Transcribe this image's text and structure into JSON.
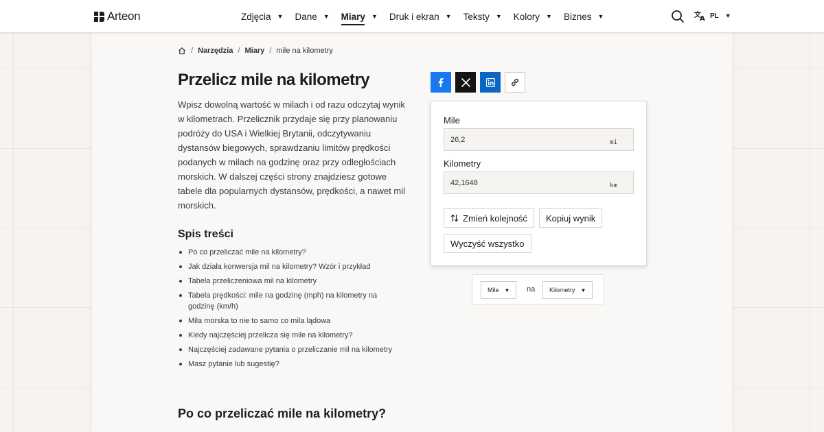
{
  "header": {
    "logo_text": "Arteon",
    "nav": [
      {
        "label": "Zdjęcia",
        "active": false
      },
      {
        "label": "Dane",
        "active": false
      },
      {
        "label": "Miary",
        "active": true
      },
      {
        "label": "Druk i ekran",
        "active": false
      },
      {
        "label": "Teksty",
        "active": false
      },
      {
        "label": "Kolory",
        "active": false
      },
      {
        "label": "Biznes",
        "active": false
      }
    ],
    "caret": "▼",
    "language": "PL"
  },
  "breadcrumb": {
    "separator": "/",
    "items": [
      "Narzędzia",
      "Miary"
    ],
    "current": "mile na kilometry"
  },
  "page": {
    "title": "Przelicz mile na kilometry",
    "intro": "Wpisz dowolną wartość w milach i od razu odczytaj wynik w kilometrach. Przelicznik przydaje się przy planowaniu podróży do USA i Wielkiej Brytanii, odczytywaniu dystansów biegowych, sprawdzaniu limitów prędkości podanych w milach na godzinę oraz przy odległościach morskich. W dalszej części strony znajdziesz gotowe tabele dla popularnych dystansów, prędkości, a nawet mil morskich.",
    "toc_title": "Spis treści",
    "toc": [
      "Po co przeliczać mile na kilometry?",
      "Jak działa konwersja mil na kilometry? Wzór i przykład",
      "Tabela przeliczeniowa mil na kilometry",
      "Tabela prędkości: mile na godzinę (mph) na kilometry na godzinę (km/h)",
      "Mila morska to nie to samo co mila lądowa",
      "Kiedy najczęściej przelicza się mile na kilometry?",
      "Najczęściej zadawane pytania o przeliczanie mil na kilometry",
      "Masz pytanie lub sugestię?"
    ],
    "section_heading": "Po co przeliczać mile na kilometry?"
  },
  "converter": {
    "from_label": "Mile",
    "from_value": "26,2",
    "from_unit": "mi",
    "to_label": "Kilometry",
    "to_value": "42,1648",
    "to_unit": "km",
    "swap_label": "Zmień kolejność",
    "copy_label": "Kopiuj wynik",
    "clear_label": "Wyczyść wszystko"
  },
  "unit_selector": {
    "from_unit": "Mile",
    "connector": "na",
    "to_unit": "Kilometry"
  },
  "colors": {
    "facebook": "#1877f2",
    "x": "#141414",
    "linkedin": "#0a66c2"
  },
  "icons": [
    "home-icon",
    "search-icon",
    "translate-icon",
    "facebook-icon",
    "x-icon",
    "linkedin-icon",
    "link-icon",
    "swap-icon"
  ]
}
